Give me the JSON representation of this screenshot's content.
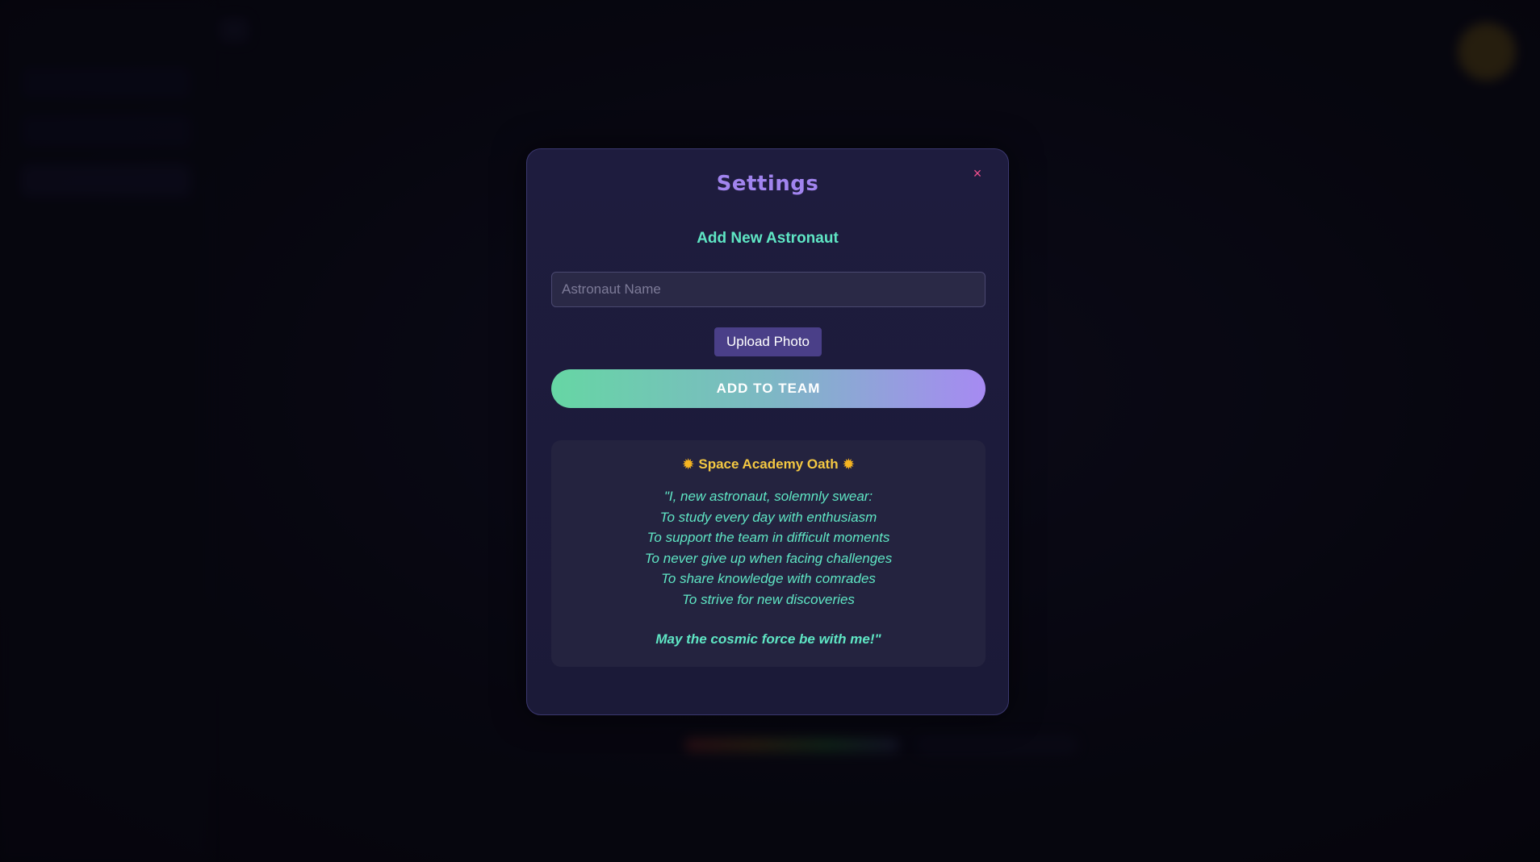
{
  "modal": {
    "title": "Settings",
    "close_label": "×",
    "section_title": "Add New Astronaut",
    "name_input": {
      "placeholder": "Astronaut Name",
      "value": ""
    },
    "upload_label": "Upload Photo",
    "add_label": "ADD TO TEAM",
    "oath": {
      "title": "Space Academy Oath",
      "icon": "sun-icon",
      "lines": [
        "\"I, new astronaut, solemnly swear:",
        "To study every day with enthusiasm",
        "To support the team in difficult moments",
        "To never give up when facing challenges",
        "To share knowledge with comrades",
        "To strive for new discoveries"
      ],
      "closing": "May the cosmic force be with me!\""
    }
  },
  "colors": {
    "title": "#a184ef",
    "accent_teal": "#5fe6c4",
    "oath_gold": "#f4c842",
    "close": "#ef4f8e",
    "upload_button": "#4a3f88",
    "add_gradient_start": "#66d6a4",
    "add_gradient_end": "#a68af2"
  }
}
